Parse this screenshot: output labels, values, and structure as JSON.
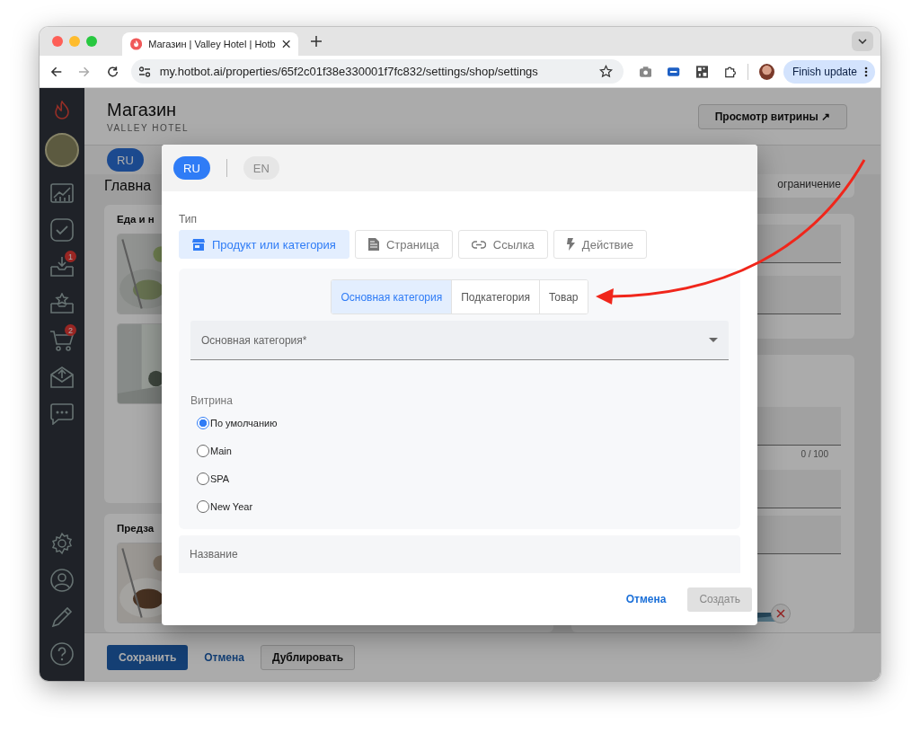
{
  "browser": {
    "tab_title": "Магазин | Valley Hotel | Hotb",
    "url": "my.hotbot.ai/properties/65f2c01f38e330001f7fc832/settings/shop/settings",
    "update_button": "Finish update"
  },
  "sidebar": {
    "top": [
      {
        "kind": "chart"
      },
      {
        "kind": "check"
      },
      {
        "kind": "inbox",
        "badge": "1"
      },
      {
        "kind": "star-tray"
      },
      {
        "kind": "cart",
        "badge": "2"
      },
      {
        "kind": "mail"
      },
      {
        "kind": "chat"
      }
    ],
    "bottom": [
      {
        "kind": "gear"
      },
      {
        "kind": "user"
      },
      {
        "kind": "pencil"
      },
      {
        "kind": "help"
      }
    ]
  },
  "page": {
    "title": "Магазин",
    "subtitle": "VALLEY HOTEL",
    "preview_button": "Просмотр витрины ↗",
    "languages": [
      {
        "label": "RU",
        "selected": true
      }
    ],
    "section_title": "Главна",
    "groups": [
      {
        "title": "Еда и н"
      },
      {
        "title": "Предза"
      }
    ],
    "right_text": "ограничение",
    "counter": "0 / 100",
    "save": "Сохранить",
    "cancel": "Отмена",
    "duplicate": "Дублировать"
  },
  "dialog": {
    "languages": [
      {
        "label": "RU",
        "selected": true
      },
      {
        "label": "EN",
        "selected": false
      }
    ],
    "type_label": "Тип",
    "types": [
      {
        "kind": "store",
        "label": "Продукт или категория",
        "selected": true
      },
      {
        "kind": "page",
        "label": "Страница",
        "selected": false
      },
      {
        "kind": "link",
        "label": "Ссылка",
        "selected": false
      },
      {
        "kind": "bolt",
        "label": "Действие",
        "selected": false
      }
    ],
    "levels": [
      {
        "label": "Основная категория",
        "selected": true
      },
      {
        "label": "Подкатегория",
        "selected": false
      },
      {
        "label": "Товар",
        "selected": false
      }
    ],
    "category_select": {
      "placeholder": "Основная категория*"
    },
    "showcase_label": "Витрина",
    "showcases": [
      {
        "label": "По умолчанию",
        "selected": true
      },
      {
        "label": "Main",
        "selected": false
      },
      {
        "label": "SPA",
        "selected": false
      },
      {
        "label": "New Year",
        "selected": false
      }
    ],
    "name_field": {
      "placeholder": "Название"
    },
    "cancel": "Отмена",
    "create": "Создать",
    "create_disabled": true
  }
}
